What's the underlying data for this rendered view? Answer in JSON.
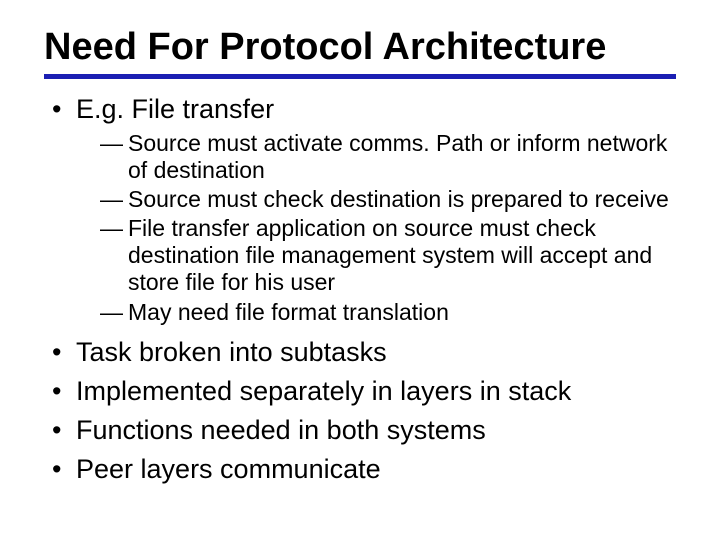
{
  "title": "Need For Protocol Architecture",
  "bullets": [
    {
      "text": "E.g. File transfer",
      "sub": [
        "Source must activate comms. Path or inform network of destination",
        "Source must check destination is prepared to receive",
        "File transfer application on source must check destination file management system will accept and store file for his user",
        "May need file format translation"
      ]
    },
    {
      "text": "Task broken into subtasks"
    },
    {
      "text": "Implemented separately in layers in stack"
    },
    {
      "text": "Functions needed in both systems"
    },
    {
      "text": "Peer layers communicate"
    }
  ]
}
